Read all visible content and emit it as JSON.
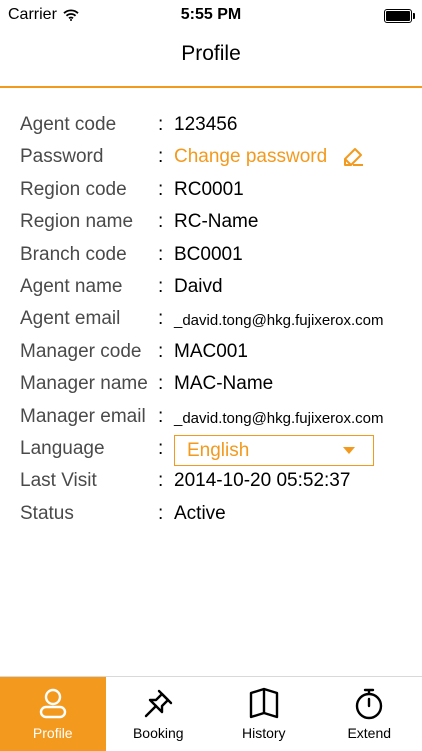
{
  "status_bar": {
    "carrier": "Carrier",
    "time": "5:55 PM",
    "wifi_icon": "wifi-icon",
    "battery_icon": "battery-icon"
  },
  "nav": {
    "title": "Profile"
  },
  "colors": {
    "accent": "#f39a1e",
    "label": "#4a4a4a",
    "text": "#000000"
  },
  "details": {
    "colon": ":",
    "agent_code": {
      "label": "Agent code",
      "value": "123456"
    },
    "password": {
      "label": "Password",
      "action": "Change password",
      "icon": "pen-edit-icon"
    },
    "region_code": {
      "label": "Region code",
      "value": "RC0001"
    },
    "region_name": {
      "label": "Region name",
      "value": "RC-Name"
    },
    "branch_code": {
      "label": "Branch code",
      "value": "BC0001"
    },
    "agent_name": {
      "label": "Agent name",
      "value": "Daivd"
    },
    "agent_email": {
      "label": "Agent email",
      "value": "_david.tong@hkg.fujixerox.com"
    },
    "manager_code": {
      "label": "Manager code",
      "value": "MAC001"
    },
    "manager_name": {
      "label": "Manager name",
      "value": "MAC-Name"
    },
    "manager_email": {
      "label": "Manager email",
      "value": "_david.tong@hkg.fujixerox.com"
    },
    "language": {
      "label": "Language",
      "selected": "English"
    },
    "last_visit": {
      "label": "Last Visit",
      "value": "2014-10-20 05:52:37"
    },
    "status": {
      "label": "Status",
      "value": "Active"
    }
  },
  "tabs": [
    {
      "label": "Profile",
      "icon": "person-icon",
      "active": true
    },
    {
      "label": "Booking",
      "icon": "pushpin-icon",
      "active": false
    },
    {
      "label": "History",
      "icon": "book-icon",
      "active": false
    },
    {
      "label": "Extend",
      "icon": "stopwatch-icon",
      "active": false
    }
  ]
}
